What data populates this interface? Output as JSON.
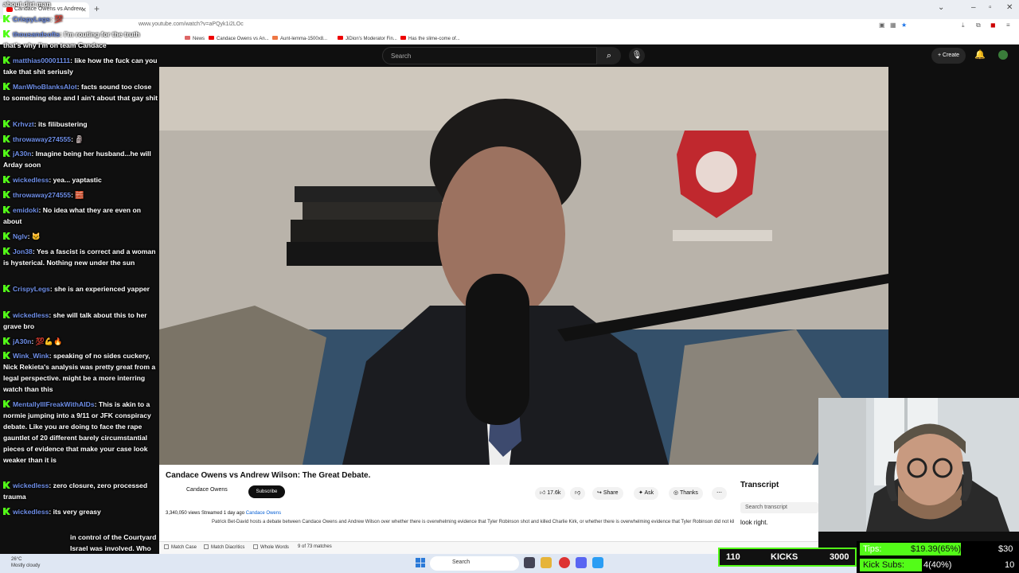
{
  "browser": {
    "tab_title": "Candace Owens vs Andrew",
    "url": "www.youtube.com/watch?v=aPQyk1i2LOc",
    "bookmarks": [
      "Candace Owens vs An...",
      "News",
      "Candace Owens vs An...",
      "Aunt-lemma-1500x8...",
      "JiDion's Moderator Fin...",
      "Has the slime-come of..."
    ]
  },
  "youtube": {
    "search_placeholder": "Search",
    "create_label": "Create",
    "video_title": "Candace Owens vs Andrew Wilson: The Great Debate.",
    "channel": "Candace Owens",
    "subscribe_label": "Subscribe",
    "likes": "17.6k",
    "share_label": "Share",
    "ask_label": "Ask",
    "thanks_label": "Thanks",
    "views_date": "3,340,050 views  Streamed 1 day ago",
    "tag": "Candace Owens",
    "description": "Patrick Bet-David hosts a debate between Candace Owens and Andrew Wilson over whether there is overwhelming evidence that Tyler Robinson shot and killed Charlie Kirk, or whether there is overwhelming evidence that Tyler Robinson did not kill Charlie Kirk and is being set up as a patsy.",
    "transcript_title": "Transcript",
    "transcript_search": "Search transcript",
    "transcript_line": "look right."
  },
  "find_bar": {
    "match_case": "Match Case",
    "match_diacritics": "Match Diacritics",
    "whole_words": "Whole Words",
    "matches": "9 of 73 matches"
  },
  "chat": {
    "messages": [
      {
        "user": "",
        "text": "about dirt man"
      },
      {
        "user": "CrispyLegs",
        "text": ""
      },
      {
        "user": "thousandsofts",
        "text": "I'm routing for the truth that's why I'm on team Candace"
      },
      {
        "user": "matthias00001111",
        "text": "like how the fuck can you take that shit seriusly"
      },
      {
        "user": "ManWhoBlanksAlot",
        "text": "facts sound too close to something else and I ain't about that gay shit"
      },
      {
        "user": "Krhvzt",
        "text": "its filibustering"
      },
      {
        "user": "throwaway274555",
        "text": ""
      },
      {
        "user": "jA30n",
        "text": "Imagine being her husband...he will Arday soon"
      },
      {
        "user": "wickedless",
        "text": "yea... yaptastic"
      },
      {
        "user": "throwaway274555",
        "text": ""
      },
      {
        "user": "emidoki",
        "text": "No idea what they are even on about"
      },
      {
        "user": "Nglv",
        "text": ""
      },
      {
        "user": "Jon38",
        "text": "Yes a fascist is correct and a woman is hysterical. Nothing new under the sun"
      },
      {
        "user": "CrispyLegs",
        "text": "she is an experienced yapper"
      },
      {
        "user": "wickedless",
        "text": "she will talk about this to her grave bro"
      },
      {
        "user": "jA30n",
        "text": ""
      },
      {
        "user": "Wink_Wink",
        "text": "speaking of no sides cuckery, Nick Rekieta's analysis was pretty great from a legal perspective. might be a more interring watch than this"
      },
      {
        "user": "MentallyIllFreakWithAIDs",
        "text": "This is akin to a normie jumping into a 9/11 or JFK conspiracy debate. Like you are doing to face the rape gauntlet of 20 different barely circumstantial pieces of evidence that make your case look weaker than it is"
      },
      {
        "user": "wickedless",
        "text": "zero closure, zero processed trauma"
      },
      {
        "user": "wickedless",
        "text": "its very greasy"
      },
      {
        "user": "",
        "text": "in control of the Courtyard Israel was involved. Who bidding of Israel the feds"
      }
    ]
  },
  "taskbar": {
    "weather_temp": "26°C",
    "weather_desc": "Mostly cloudy",
    "search": "Search"
  },
  "stream": {
    "kicks_current": "110",
    "kicks_label": "KICKS",
    "kicks_goal": "3000",
    "tips_label": "Tips:",
    "tips_value": "$19.39(65%)",
    "tips_goal": "$30",
    "subs_label": "Kick Subs:",
    "subs_value": "4(40%)",
    "subs_goal": "10",
    "tips_fraction": 0.65,
    "subs_fraction": 0.4
  }
}
